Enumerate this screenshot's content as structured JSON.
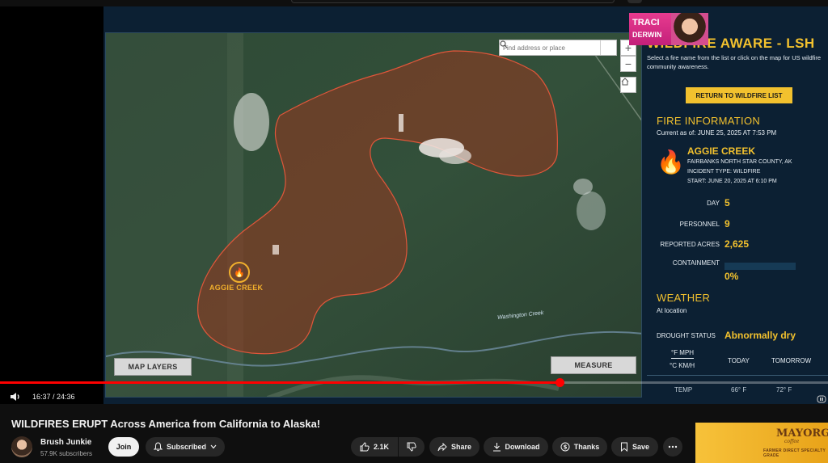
{
  "map": {
    "search_placeholder": "Find address or place",
    "zoom_in": "+",
    "zoom_out": "−",
    "map_layers_label": "MAP LAYERS",
    "measure_label": "MEASURE",
    "fire_marker_label": "AGGIE CREEK",
    "river_label": "Washington Creek"
  },
  "panel": {
    "title": "WILDFIRE AWARE - LSH",
    "description": "Select a fire name from the list or click on the map for US wildfire community awareness.",
    "return_button": "RETURN TO WILDFIRE LIST",
    "fire_info_heading": "FIRE INFORMATION",
    "current_as_of": "Current as of: JUNE 25, 2025 AT 7:53 PM",
    "fire_name": "AGGIE CREEK",
    "county": "FAIRBANKS NORTH STAR COUNTY, AK",
    "incident_type": "INCIDENT TYPE: WILDFIRE",
    "start": "START: JUNE 20, 2025 AT 6:10 PM",
    "day_label": "DAY",
    "day_value": "5",
    "personnel_label": "PERSONNEL",
    "personnel_value": "9",
    "acres_label": "REPORTED ACRES",
    "acres_value": "2,625",
    "containment_label": "CONTAINMENT",
    "containment_value": "0%",
    "containment_fraction": 0,
    "weather_heading": "WEATHER",
    "at_location": "At location",
    "drought_label": "DROUGHT STATUS",
    "drought_value": "Abnormally dry",
    "unit_f": "°F MPH",
    "unit_c": "°C KM/H",
    "today_label": "TODAY",
    "tomorrow_label": "TOMORROW",
    "temp_label": "TEMP",
    "temp_today": "66° F",
    "temp_tomorrow": "72° F"
  },
  "overlay": {
    "name_line1": "TRACI",
    "name_line2": "DERWIN"
  },
  "player": {
    "time": "16:37 / 24:36",
    "progress_fraction": 0.676
  },
  "video": {
    "title": "WILDFIRES ERUPT Across America from California to Alaska!",
    "channel": "Brush Junkie",
    "subscribers": "57.9K subscribers",
    "join_label": "Join",
    "subscribed_label": "Subscribed",
    "likes": "2.1K",
    "share_label": "Share",
    "download_label": "Download",
    "thanks_label": "Thanks",
    "save_label": "Save"
  },
  "ad": {
    "brand": "MAYORGA",
    "sub": "coffee",
    "tag": "FARMER DIRECT SPECIALTY GRADE"
  },
  "colors": {
    "accent": "#f2c12e",
    "panel_bg": "#0c2033",
    "progress": "#ff0000"
  }
}
